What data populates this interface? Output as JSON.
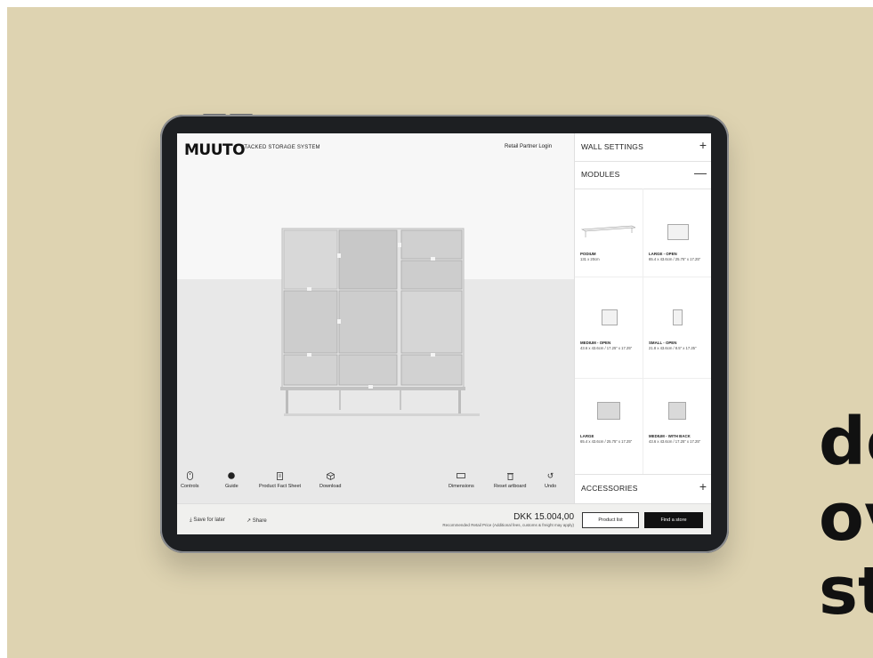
{
  "brand": {
    "logo": "MUUTO",
    "breadcrumb_arrow": "←",
    "breadcrumb": "STACKED STORAGE SYSTEM"
  },
  "header": {
    "retail_login": "Retail Partner Login"
  },
  "panel": {
    "wall_settings": {
      "label": "WALL SETTINGS",
      "sign": "+"
    },
    "modules": {
      "label": "MODULES",
      "sign": "—"
    },
    "accessories": {
      "label": "ACCESSORIES",
      "sign": "+"
    },
    "items": [
      {
        "name": "PODIUM",
        "dims": "131 x 20cm"
      },
      {
        "name": "LARGE - OPEN",
        "dims": "65.4 x 43.6cm / 25.75\" x 17.25\""
      },
      {
        "name": "MEDIUM - OPEN",
        "dims": "43.6 x 43.6cm / 17.25\" x 17.25\""
      },
      {
        "name": "SMALL - OPEN",
        "dims": "21.8 x 43.6cm / 8.5\" x 17.25\""
      },
      {
        "name": "LARGE",
        "dims": "65.4 x 43.6cm / 25.75\" x 17.25\""
      },
      {
        "name": "MEDIUM - WITH BACK",
        "dims": "43.6 x 43.6cm / 17.25\" x 17.25\""
      }
    ]
  },
  "toolbar": {
    "controls": "Controls",
    "guide": "Guide",
    "fact_sheet": "Product Fact Sheet",
    "download": "Download",
    "dimensions": "Dimensions",
    "reset": "Reset artboard",
    "undo": "Undo"
  },
  "footer": {
    "save": "Save for later",
    "share": "Share",
    "price": "DKK 15.004,00",
    "price_note": "Recommended Retail Price (Additional fees, customs & freight may apply)",
    "product_list": "Product list",
    "find_store": "Find a store"
  },
  "overlay_text": [
    "de",
    "ov",
    "st"
  ],
  "colors": {
    "background": "#ded3b1",
    "tablet": "#1d1f22",
    "cta": "#111111"
  }
}
